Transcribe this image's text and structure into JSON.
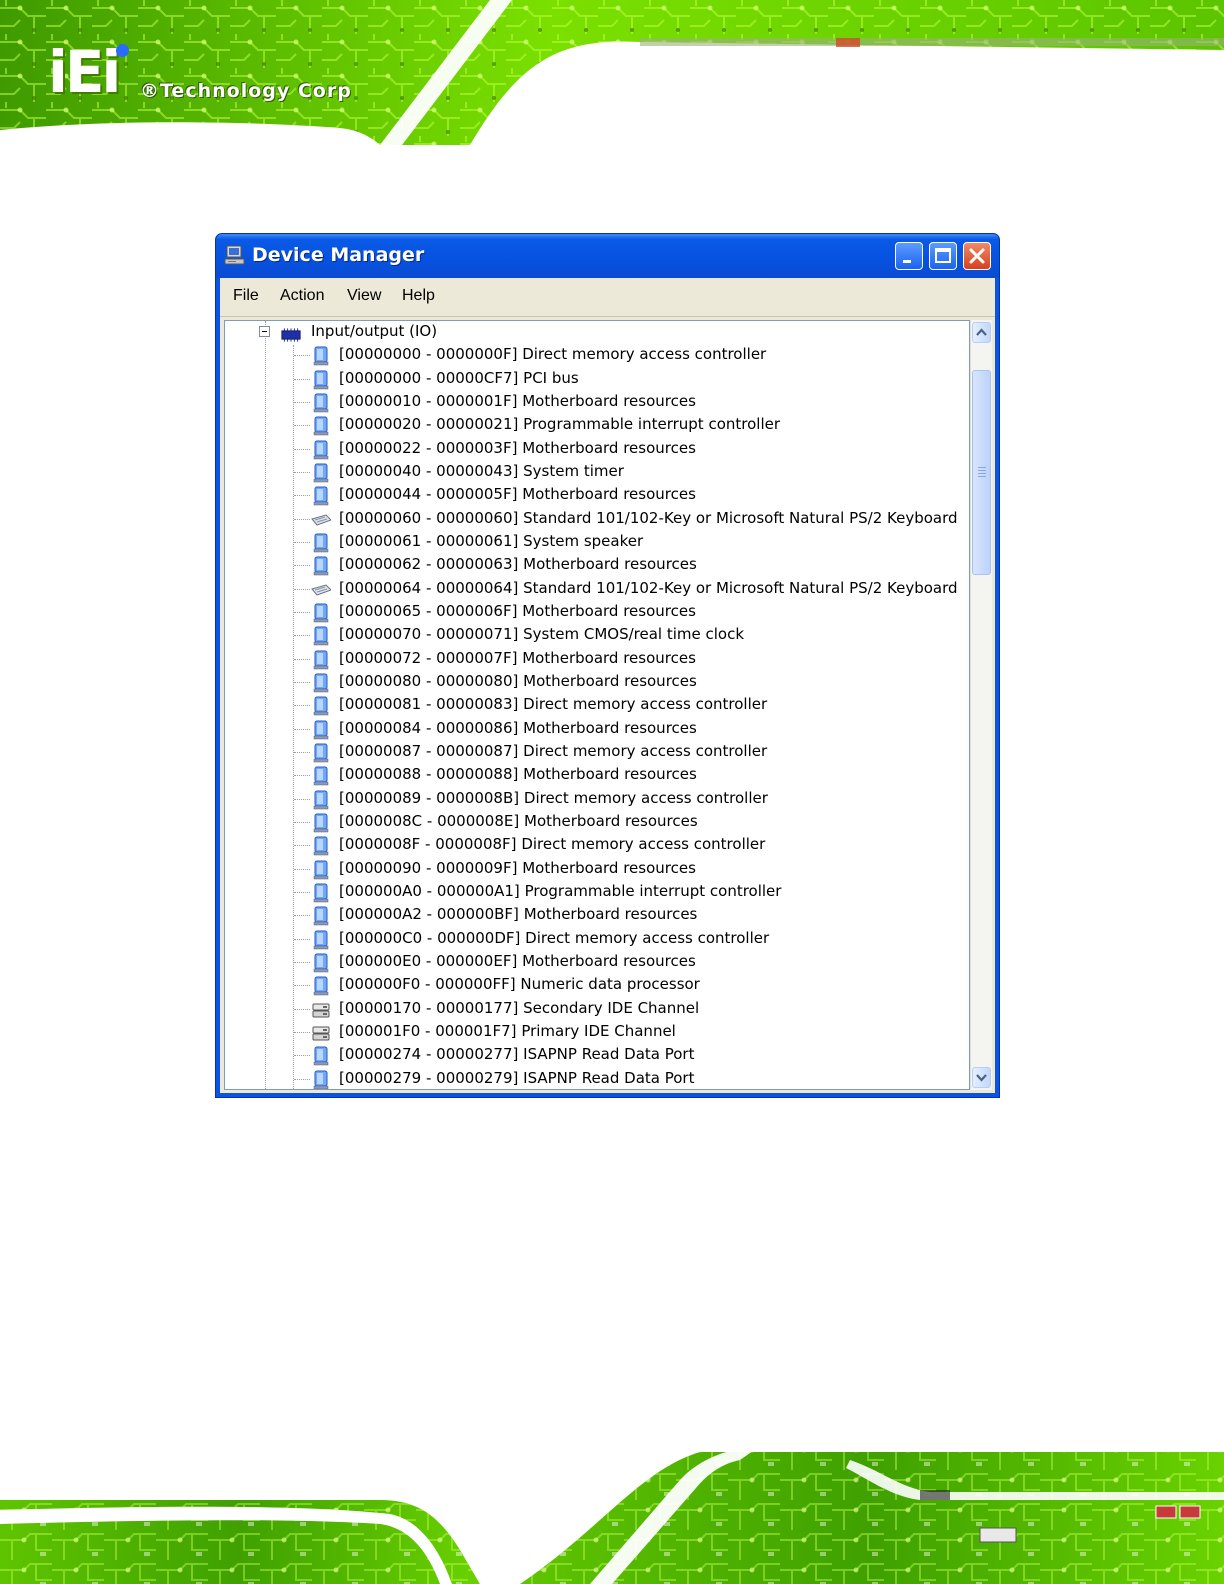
{
  "brand": {
    "logo_text": "iEi",
    "company": "®Technology Corp"
  },
  "window": {
    "title": "Device Manager",
    "icon": "computer-icon",
    "controls": [
      "minimize-icon",
      "maximize-icon",
      "close-icon"
    ]
  },
  "menu": {
    "items": [
      "File",
      "Action",
      "View",
      "Help"
    ]
  },
  "tree": {
    "root": {
      "label": "Input/output (IO)",
      "icon": "io-chip-icon",
      "expanded": true
    },
    "items": [
      {
        "range": "[00000000 - 0000000F]",
        "name": "Direct memory access controller",
        "icon": "system-device-icon"
      },
      {
        "range": "[00000000 - 00000CF7]",
        "name": "PCI bus",
        "icon": "system-device-icon"
      },
      {
        "range": "[00000010 - 0000001F]",
        "name": "Motherboard resources",
        "icon": "system-device-icon"
      },
      {
        "range": "[00000020 - 00000021]",
        "name": "Programmable interrupt controller",
        "icon": "system-device-icon"
      },
      {
        "range": "[00000022 - 0000003F]",
        "name": "Motherboard resources",
        "icon": "system-device-icon"
      },
      {
        "range": "[00000040 - 00000043]",
        "name": "System timer",
        "icon": "system-device-icon"
      },
      {
        "range": "[00000044 - 0000005F]",
        "name": "Motherboard resources",
        "icon": "system-device-icon"
      },
      {
        "range": "[00000060 - 00000060]",
        "name": "Standard 101/102-Key or Microsoft Natural PS/2 Keyboard",
        "icon": "keyboard-icon"
      },
      {
        "range": "[00000061 - 00000061]",
        "name": "System speaker",
        "icon": "system-device-icon"
      },
      {
        "range": "[00000062 - 00000063]",
        "name": "Motherboard resources",
        "icon": "system-device-icon"
      },
      {
        "range": "[00000064 - 00000064]",
        "name": "Standard 101/102-Key or Microsoft Natural PS/2 Keyboard",
        "icon": "keyboard-icon"
      },
      {
        "range": "[00000065 - 0000006F]",
        "name": "Motherboard resources",
        "icon": "system-device-icon"
      },
      {
        "range": "[00000070 - 00000071]",
        "name": "System CMOS/real time clock",
        "icon": "system-device-icon"
      },
      {
        "range": "[00000072 - 0000007F]",
        "name": "Motherboard resources",
        "icon": "system-device-icon"
      },
      {
        "range": "[00000080 - 00000080]",
        "name": "Motherboard resources",
        "icon": "system-device-icon"
      },
      {
        "range": "[00000081 - 00000083]",
        "name": "Direct memory access controller",
        "icon": "system-device-icon"
      },
      {
        "range": "[00000084 - 00000086]",
        "name": "Motherboard resources",
        "icon": "system-device-icon"
      },
      {
        "range": "[00000087 - 00000087]",
        "name": "Direct memory access controller",
        "icon": "system-device-icon"
      },
      {
        "range": "[00000088 - 00000088]",
        "name": "Motherboard resources",
        "icon": "system-device-icon"
      },
      {
        "range": "[00000089 - 0000008B]",
        "name": "Direct memory access controller",
        "icon": "system-device-icon"
      },
      {
        "range": "[0000008C - 0000008E]",
        "name": "Motherboard resources",
        "icon": "system-device-icon"
      },
      {
        "range": "[0000008F - 0000008F]",
        "name": "Direct memory access controller",
        "icon": "system-device-icon"
      },
      {
        "range": "[00000090 - 0000009F]",
        "name": "Motherboard resources",
        "icon": "system-device-icon"
      },
      {
        "range": "[000000A0 - 000000A1]",
        "name": "Programmable interrupt controller",
        "icon": "system-device-icon"
      },
      {
        "range": "[000000A2 - 000000BF]",
        "name": "Motherboard resources",
        "icon": "system-device-icon"
      },
      {
        "range": "[000000C0 - 000000DF]",
        "name": "Direct memory access controller",
        "icon": "system-device-icon"
      },
      {
        "range": "[000000E0 - 000000EF]",
        "name": "Motherboard resources",
        "icon": "system-device-icon"
      },
      {
        "range": "[000000F0 - 000000FF]",
        "name": "Numeric data processor",
        "icon": "system-device-icon"
      },
      {
        "range": "[00000170 - 00000177]",
        "name": "Secondary IDE Channel",
        "icon": "ide-channel-icon"
      },
      {
        "range": "[000001F0 - 000001F7]",
        "name": "Primary IDE Channel",
        "icon": "ide-channel-icon"
      },
      {
        "range": "[00000274 - 00000277]",
        "name": "ISAPNP Read Data Port",
        "icon": "system-device-icon"
      },
      {
        "range": "[00000279 - 00000279]",
        "name": "ISAPNP Read Data Port",
        "icon": "system-device-icon"
      }
    ]
  },
  "scrollbar": {
    "position_fraction": 0.0,
    "icons": [
      "scroll-up-arrow-icon",
      "scroll-down-arrow-icon"
    ]
  },
  "colors": {
    "title_bar": "#0A54E3",
    "circuit_green": "#6FD400",
    "menu_bg": "#ECE9D8"
  }
}
